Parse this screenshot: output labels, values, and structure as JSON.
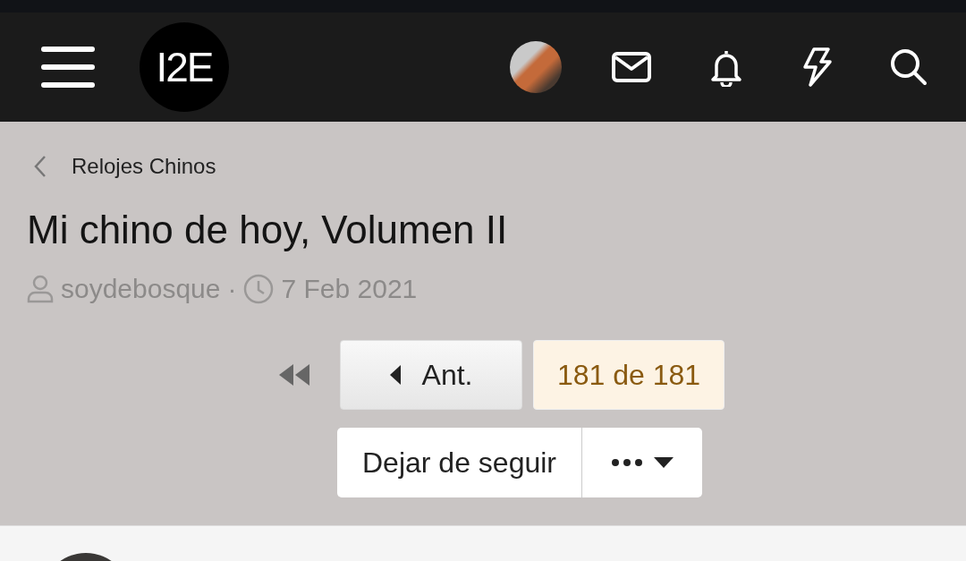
{
  "header": {
    "logo": "I2E"
  },
  "breadcrumb": {
    "label": "Relojes Chinos"
  },
  "thread": {
    "title": "Mi chino de hoy, Volumen II",
    "author": "soydebosque",
    "separator": "·",
    "date": "7 Feb 2021"
  },
  "pagination": {
    "previous": "Ant.",
    "current": "181 de 181"
  },
  "actions": {
    "unfollow": "Dejar de seguir"
  }
}
